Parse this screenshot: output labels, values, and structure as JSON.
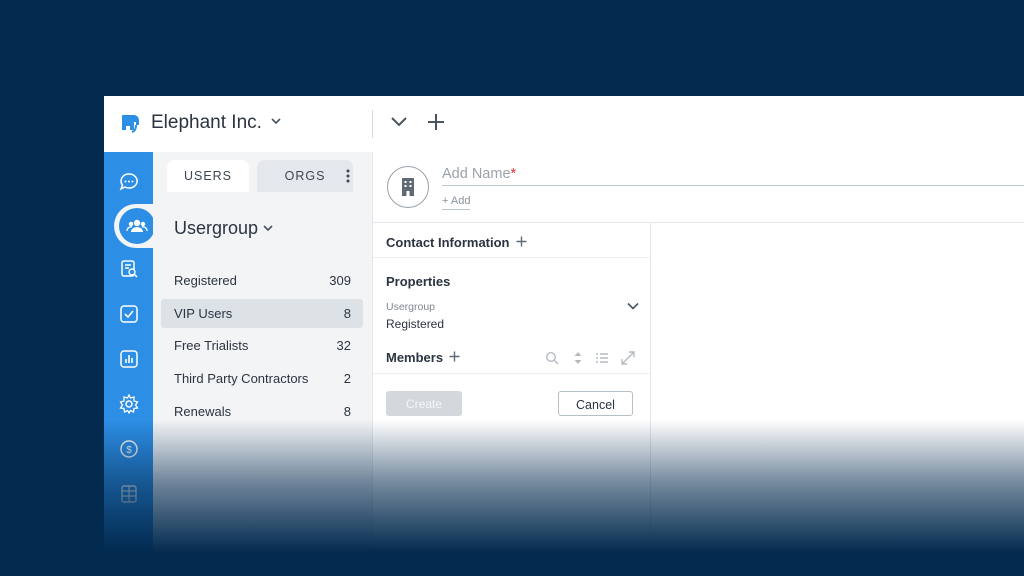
{
  "header": {
    "org_name": "Elephant Inc."
  },
  "rail": {
    "items": [
      "chat-icon",
      "users-icon",
      "search-document-icon",
      "checkbox-icon",
      "analytics-icon",
      "gear-icon",
      "dollar-icon",
      "grid-icon"
    ],
    "active": "users-icon",
    "accent": "#2d8ee6"
  },
  "panel": {
    "tabs": [
      {
        "label": "USERS",
        "active": true
      },
      {
        "label": "ORGS",
        "active": false
      }
    ],
    "group_title": "Usergroup",
    "items": [
      {
        "label": "Registered",
        "count": "309"
      },
      {
        "label": "VIP Users",
        "count": "8",
        "selected": true
      },
      {
        "label": "Free Trialists",
        "count": "32"
      },
      {
        "label": "Third Party Contractors",
        "count": "2"
      },
      {
        "label": "Renewals",
        "count": "8"
      }
    ]
  },
  "main": {
    "name_placeholder": "Add Name",
    "required_mark": "*",
    "add_link": "+ Add",
    "contact_title": "Contact Information",
    "properties_title": "Properties",
    "usergroup_label": "Usergroup",
    "usergroup_value": "Registered",
    "members_title": "Members",
    "create_label": "Create",
    "cancel_label": "Cancel"
  }
}
